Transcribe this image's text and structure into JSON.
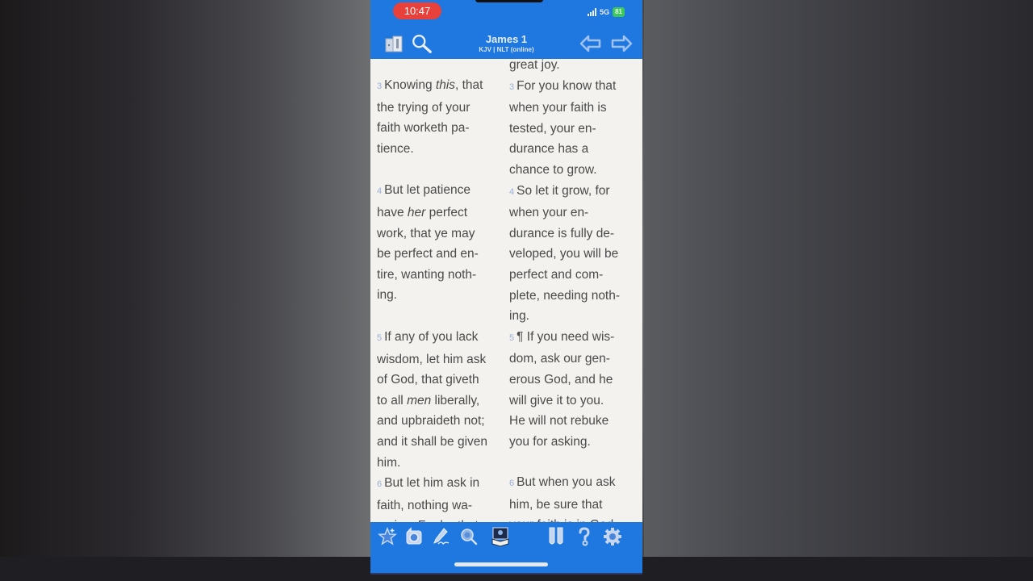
{
  "status_bar": {
    "time": "10:47",
    "network": "5G",
    "battery": "81"
  },
  "nav": {
    "title": "James 1",
    "subtitle": "KJV | NLT (online)",
    "left_icons": [
      "library-icon",
      "search-icon"
    ],
    "right_icons": [
      "previous-chapter-icon",
      "next-chapter-icon"
    ]
  },
  "reader": {
    "top_fragment_right": "great joy.",
    "verses": [
      {
        "number": "3",
        "kjv": [
          {
            "t": "Knowing "
          },
          {
            "t": "this",
            "i": true
          },
          {
            "t": ", that\nthe trying of your\nfaith worketh pa-\ntience."
          }
        ],
        "nlt": "For you know that\nwhen your faith is\ntested, your en-\ndurance has a\nchance to grow."
      },
      {
        "number": "4",
        "kjv": [
          {
            "t": "But let patience\nhave "
          },
          {
            "t": "her",
            "i": true
          },
          {
            "t": " perfect\nwork, that ye may\nbe perfect and en-\ntire, wanting noth-\ning."
          }
        ],
        "nlt": "So let it grow, for\nwhen your en-\ndurance is fully de-\nveloped, you will be\nperfect and com-\nplete, needing noth-\ning."
      },
      {
        "number": "5",
        "kjv": [
          {
            "t": "If any of you lack\nwisdom, let him ask\nof God, that giveth\nto all "
          },
          {
            "t": "men",
            "i": true
          },
          {
            "t": " liberally,\nand upbraideth not;\nand it shall be given\nhim."
          }
        ],
        "nlt": "¶ If you need wis-\ndom, ask our gen-\nerous God, and he\nwill give it to you.\nHe will not rebuke\nyou for asking."
      },
      {
        "number": "6",
        "kjv": [
          {
            "t": "But let him ask in\nfaith, nothing wa-\nvering. For he that"
          }
        ],
        "nlt": "But when you ask\nhim, be sure that\nyour faith is in God"
      }
    ]
  },
  "toolbar": {
    "items": [
      {
        "name": "bookmark-star-icon"
      },
      {
        "name": "history-icon"
      },
      {
        "name": "notes-pen-icon"
      },
      {
        "name": "search-lens-icon"
      },
      {
        "name": "reading-plan-icon"
      },
      {
        "name": "parallel-columns-icon"
      },
      {
        "name": "help-icon"
      },
      {
        "name": "settings-gear-icon"
      }
    ]
  },
  "colors": {
    "accent": "#1f78e0",
    "time_pill": "#e8403a",
    "battery": "#3cc85a",
    "page": "#f3f2ee",
    "text": "#4a4a4a",
    "verse_number": "#9bb0d8"
  }
}
